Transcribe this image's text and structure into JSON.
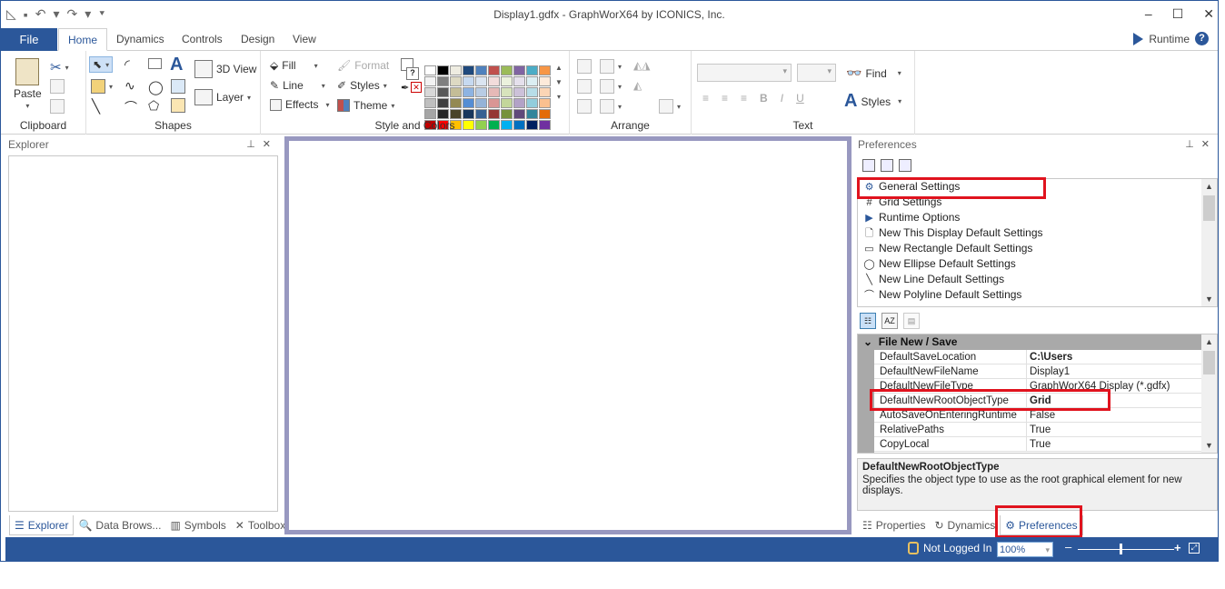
{
  "window": {
    "title": "Display1.gdfx - GraphWorX64 by ICONICS, Inc."
  },
  "ribbon": {
    "file_tab": "File",
    "tabs": [
      "Home",
      "Dynamics",
      "Controls",
      "Design",
      "View"
    ],
    "runtime_label": "Runtime",
    "groups": {
      "clipboard": {
        "label": "Clipboard",
        "paste": "Paste"
      },
      "shapes": {
        "label": "Shapes",
        "view3d": "3D View",
        "layer": "Layer"
      },
      "style": {
        "label": "Style and Colors",
        "fill": "Fill",
        "line": "Line",
        "effects": "Effects",
        "format": "Format",
        "styles": "Styles",
        "theme": "Theme"
      },
      "arrange": {
        "label": "Arrange"
      },
      "text": {
        "label": "Text",
        "find": "Find",
        "styles": "Styles"
      }
    },
    "swatch_colors": [
      "#ffffff",
      "#000000",
      "#eeece1",
      "#1f497d",
      "#4f81bd",
      "#c0504d",
      "#9bbb59",
      "#8064a2",
      "#4bacc6",
      "#f79646",
      "#f2f2f2",
      "#7f7f7f",
      "#ddd9c3",
      "#c6d9f0",
      "#dbe5f1",
      "#f2dcdb",
      "#ebf1dd",
      "#e5e0ec",
      "#dbeef3",
      "#fdeada",
      "#d8d8d8",
      "#595959",
      "#c4bd97",
      "#8db3e2",
      "#b8cce4",
      "#e5b9b7",
      "#d7e3bc",
      "#ccc1d9",
      "#b7dde8",
      "#fbd5b5",
      "#bfbfbf",
      "#3f3f3f",
      "#938953",
      "#548dd4",
      "#95b3d7",
      "#d99694",
      "#c3d69b",
      "#b2a2c7",
      "#92cddc",
      "#fac08f",
      "#a5a5a5",
      "#262626",
      "#494429",
      "#17365d",
      "#366092",
      "#953734",
      "#76923c",
      "#5f497a",
      "#31859b",
      "#e36c09",
      "#c00000",
      "#ff0000",
      "#ffc000",
      "#ffff00",
      "#92d050",
      "#00b050",
      "#00b0f0",
      "#0070c0",
      "#002060",
      "#7030a0"
    ]
  },
  "explorer": {
    "title": "Explorer",
    "tabs": [
      "Explorer",
      "Data Brows...",
      "Symbols",
      "Toolbox"
    ]
  },
  "preferences": {
    "title": "Preferences",
    "items": [
      {
        "label": "General Settings",
        "icon": "gear-icon"
      },
      {
        "label": "Grid Settings",
        "icon": "grid-icon"
      },
      {
        "label": "Runtime Options",
        "icon": "play-icon"
      },
      {
        "label": "New This Display Default Settings",
        "icon": "page-icon"
      },
      {
        "label": "New Rectangle Default Settings",
        "icon": "rectangle-icon"
      },
      {
        "label": "New Ellipse Default Settings",
        "icon": "ellipse-icon"
      },
      {
        "label": "New Line Default Settings",
        "icon": "line-icon"
      },
      {
        "label": "New Polyline Default Settings",
        "icon": "polyline-icon"
      }
    ],
    "category": "File New / Save",
    "properties": [
      {
        "name": "DefaultSaveLocation",
        "value": "C:\\Users",
        "bold": true
      },
      {
        "name": "DefaultNewFileName",
        "value": "Display1",
        "bold": false
      },
      {
        "name": "DefaultNewFileType",
        "value": "GraphWorX64 Display (*.gdfx)",
        "bold": false
      },
      {
        "name": "DefaultNewRootObjectType",
        "value": "Grid",
        "bold": true
      },
      {
        "name": "AutoSaveOnEnteringRuntime",
        "value": "False",
        "bold": false
      },
      {
        "name": "RelativePaths",
        "value": "True",
        "bold": false
      },
      {
        "name": "CopyLocal",
        "value": "True",
        "bold": false
      }
    ],
    "description_title": "DefaultNewRootObjectType",
    "description_text": "Specifies the object type to use as the root graphical element for new displays.",
    "tabs": [
      "Properties",
      "Dynamics",
      "Preferences"
    ]
  },
  "status": {
    "login": "Not Logged In",
    "zoom": "100%"
  },
  "highlight_color": "#e0131e"
}
